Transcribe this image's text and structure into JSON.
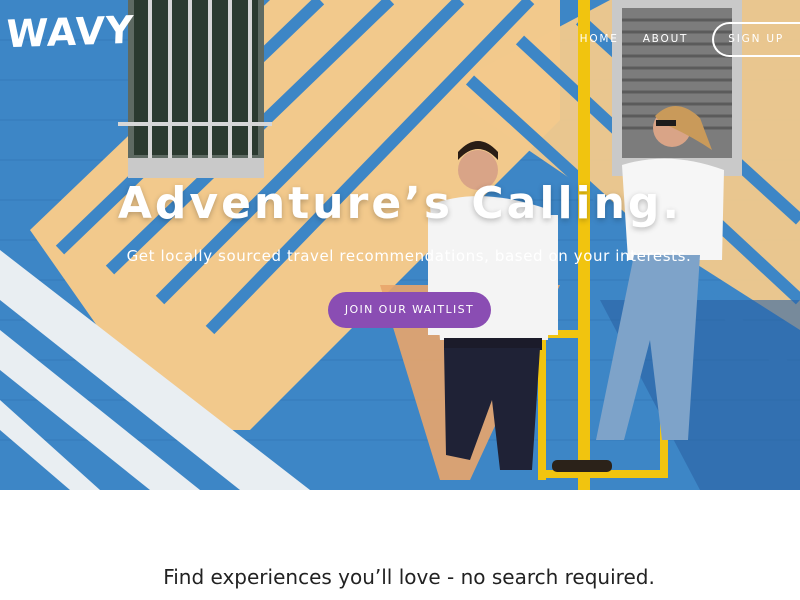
{
  "brand": {
    "logo_text": "WAVY"
  },
  "nav": {
    "links": [
      "HOME",
      "ABOUT"
    ],
    "signup_label": "SIGN UP"
  },
  "hero": {
    "headline": "Adventure’s Calling.",
    "subheadline": "Get locally sourced travel recommendations, based on your interests.",
    "cta_label": "JOIN OUR WAITLIST"
  },
  "section": {
    "tagline": "Find experiences you’ll love - no search required."
  },
  "colors": {
    "wall_blue": "#3d86c6",
    "stripe_yellow": "#f2c98c",
    "stripe_white": "#e9eef2",
    "cta_purple": "#8a4db3",
    "text_white": "#ffffff"
  }
}
